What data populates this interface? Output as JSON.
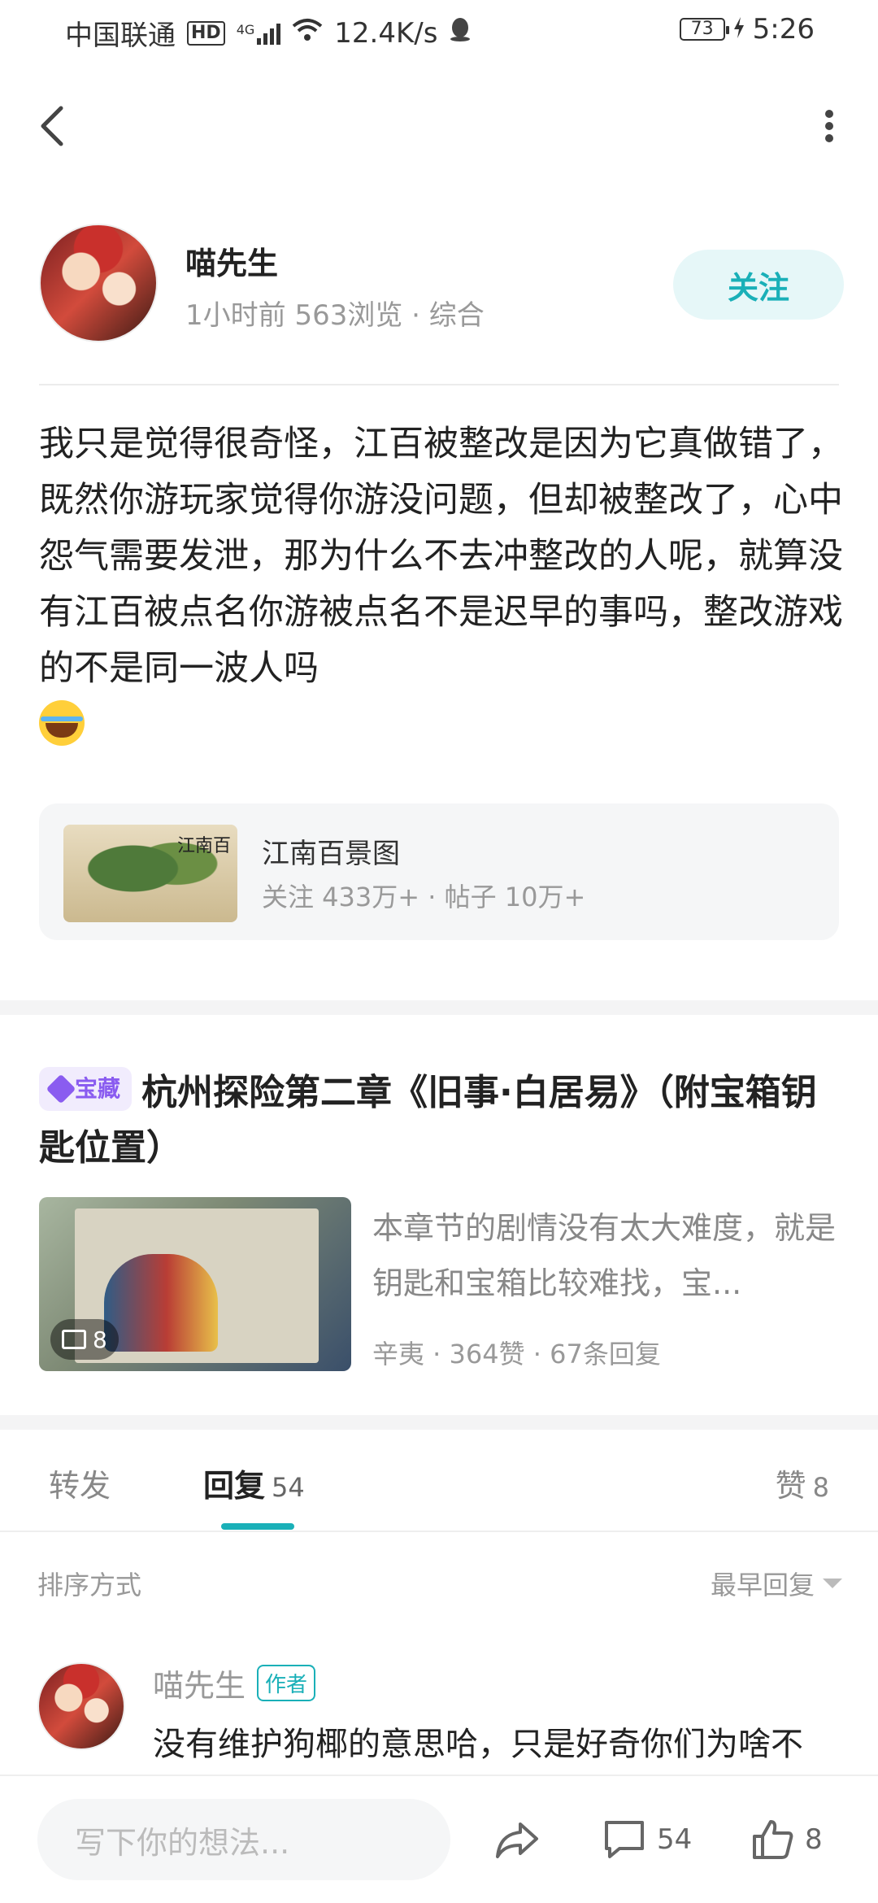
{
  "status_bar": {
    "carrier": "中国联通",
    "hd": "HD",
    "network": "4G",
    "speed": "12.4K/s",
    "battery": "73",
    "time": "5:26"
  },
  "header": {
    "back_icon": "chevron-left-icon",
    "more_icon": "vertical-dots-icon"
  },
  "author": {
    "name": "喵先生",
    "meta": "1小时前  563浏览 · 综合",
    "follow_label": "关注"
  },
  "post": {
    "text": "我只是觉得很奇怪，江百被整改是因为它真做错了，既然你游玩家觉得你游没问题，但却被整改了，心中怨气需要发泄，那为什么不去冲整改的人呢，就算没有江百被点名你游被点名不是迟早的事吗，整改游戏的不是同一波人吗",
    "emoji": "tears-of-joy-emoji"
  },
  "topic": {
    "thumb_ink": "江南百",
    "title": "江南百景图",
    "stats": "关注 433万+ · 帖子 10万+"
  },
  "related": {
    "badge": "宝藏",
    "title": "杭州探险第二章《旧事·白居易》（附宝箱钥匙位置）",
    "image_count": "8",
    "description": "本章节的剧情没有太大难度，就是钥匙和宝箱比较难找，宝...",
    "meta": "辛夷 · 364赞 · 67条回复"
  },
  "tabs": {
    "forward": "转发",
    "reply": "回复",
    "reply_count": "54",
    "like": "赞",
    "like_count": "8"
  },
  "sort": {
    "label": "排序方式",
    "value": "最早回复"
  },
  "comment": {
    "name": "喵先生",
    "tag": "作者",
    "text": "没有维护狗椰的意思哈，只是好奇你们为啥不"
  },
  "bottom_bar": {
    "placeholder": "写下你的想法...",
    "comment_count": "54",
    "like_count": "8"
  },
  "colors": {
    "accent": "#1ab0b8",
    "badge_purple": "#8a5cf0"
  }
}
